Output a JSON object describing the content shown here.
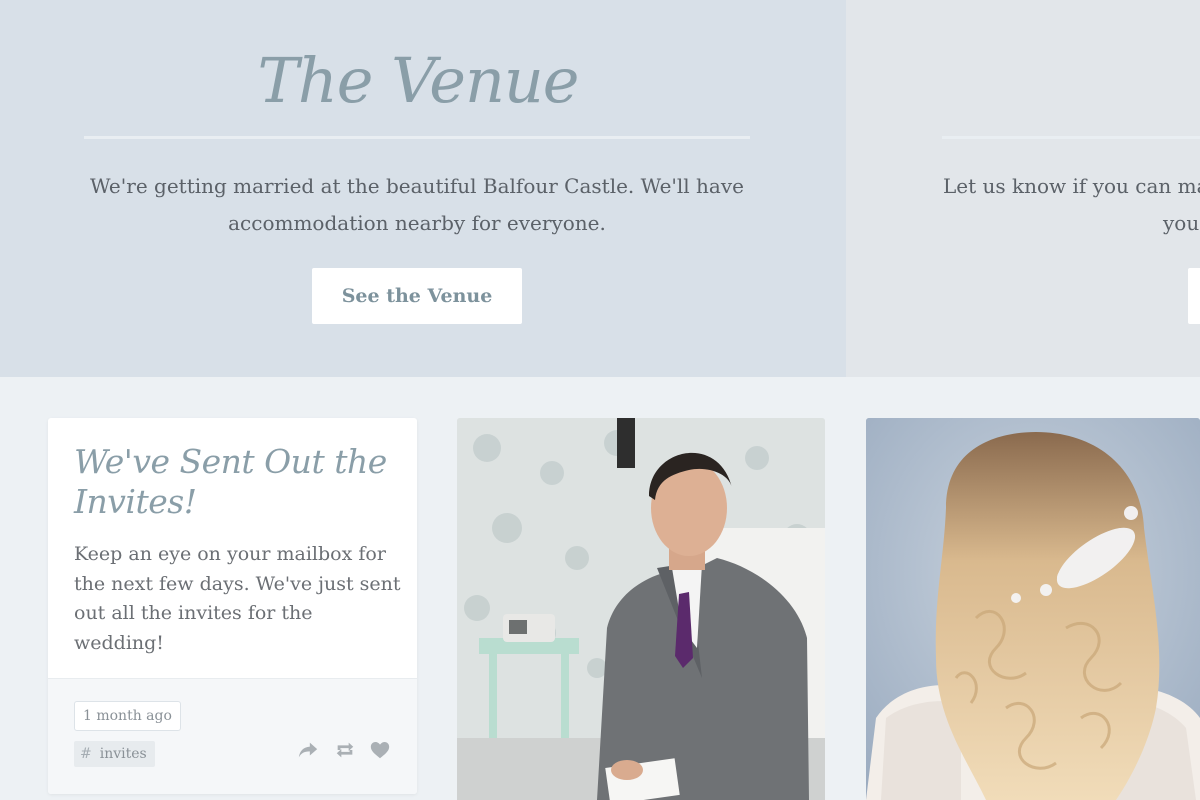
{
  "venue": {
    "title": "The Venue",
    "text": "We're getting married at the beautiful Balfour Castle. We'll have accommodation nearby for everyone.",
    "button_label": "See the Venue"
  },
  "rsvp": {
    "text_line1": "Let us know if you can ma",
    "text_line2": "you"
  },
  "post": {
    "title": "We've Sent Out the Invites!",
    "body": "Keep an eye on your mailbox for the next few days. We've just sent out all the invites for the wedding!",
    "time": "1 month ago",
    "tag_symbol": "#",
    "tag": "invites",
    "actions": [
      "share-icon",
      "reblog-icon",
      "heart-icon"
    ]
  },
  "photos": [
    {
      "subject": "groom-photo"
    },
    {
      "subject": "bride-hair-photo"
    }
  ],
  "colors": {
    "accent": "#8a9ea8",
    "hero_bg": "#d8e0e8",
    "page_bg": "#edf1f4",
    "text": "#5b6168",
    "icon": "#a8adb1"
  }
}
